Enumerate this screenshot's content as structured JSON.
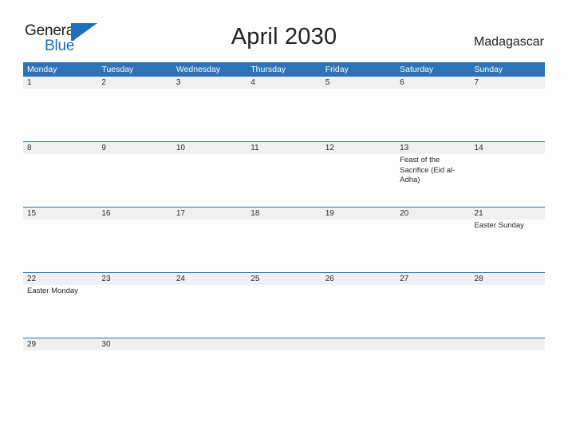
{
  "brand": {
    "name_line1": "General",
    "name_line2": "Blue",
    "mark": "flag-triangle-icon",
    "accent_color": "#1c6fb8"
  },
  "header": {
    "title": "April 2030",
    "country": "Madagascar"
  },
  "theme": {
    "header_blue": "#2e73b8",
    "day_band_gray": "#f0f0f0",
    "page_background": "#fdfdfd",
    "text_color": "#2a2a2a"
  },
  "calendar": {
    "weekdays": [
      "Monday",
      "Tuesday",
      "Wednesday",
      "Thursday",
      "Friday",
      "Saturday",
      "Sunday"
    ],
    "weeks": [
      {
        "days": [
          {
            "num": "1",
            "event": ""
          },
          {
            "num": "2",
            "event": ""
          },
          {
            "num": "3",
            "event": ""
          },
          {
            "num": "4",
            "event": ""
          },
          {
            "num": "5",
            "event": ""
          },
          {
            "num": "6",
            "event": ""
          },
          {
            "num": "7",
            "event": ""
          }
        ]
      },
      {
        "days": [
          {
            "num": "8",
            "event": ""
          },
          {
            "num": "9",
            "event": ""
          },
          {
            "num": "10",
            "event": ""
          },
          {
            "num": "11",
            "event": ""
          },
          {
            "num": "12",
            "event": ""
          },
          {
            "num": "13",
            "event": "Feast of the Sacrifice (Eid al-Adha)"
          },
          {
            "num": "14",
            "event": ""
          }
        ]
      },
      {
        "days": [
          {
            "num": "15",
            "event": ""
          },
          {
            "num": "16",
            "event": ""
          },
          {
            "num": "17",
            "event": ""
          },
          {
            "num": "18",
            "event": ""
          },
          {
            "num": "19",
            "event": ""
          },
          {
            "num": "20",
            "event": ""
          },
          {
            "num": "21",
            "event": "Easter Sunday"
          }
        ]
      },
      {
        "days": [
          {
            "num": "22",
            "event": "Easter Monday"
          },
          {
            "num": "23",
            "event": ""
          },
          {
            "num": "24",
            "event": ""
          },
          {
            "num": "25",
            "event": ""
          },
          {
            "num": "26",
            "event": ""
          },
          {
            "num": "27",
            "event": ""
          },
          {
            "num": "28",
            "event": ""
          }
        ]
      },
      {
        "days": [
          {
            "num": "29",
            "event": ""
          },
          {
            "num": "30",
            "event": ""
          },
          {
            "num": "",
            "event": ""
          },
          {
            "num": "",
            "event": ""
          },
          {
            "num": "",
            "event": ""
          },
          {
            "num": "",
            "event": ""
          },
          {
            "num": "",
            "event": ""
          }
        ]
      }
    ]
  }
}
